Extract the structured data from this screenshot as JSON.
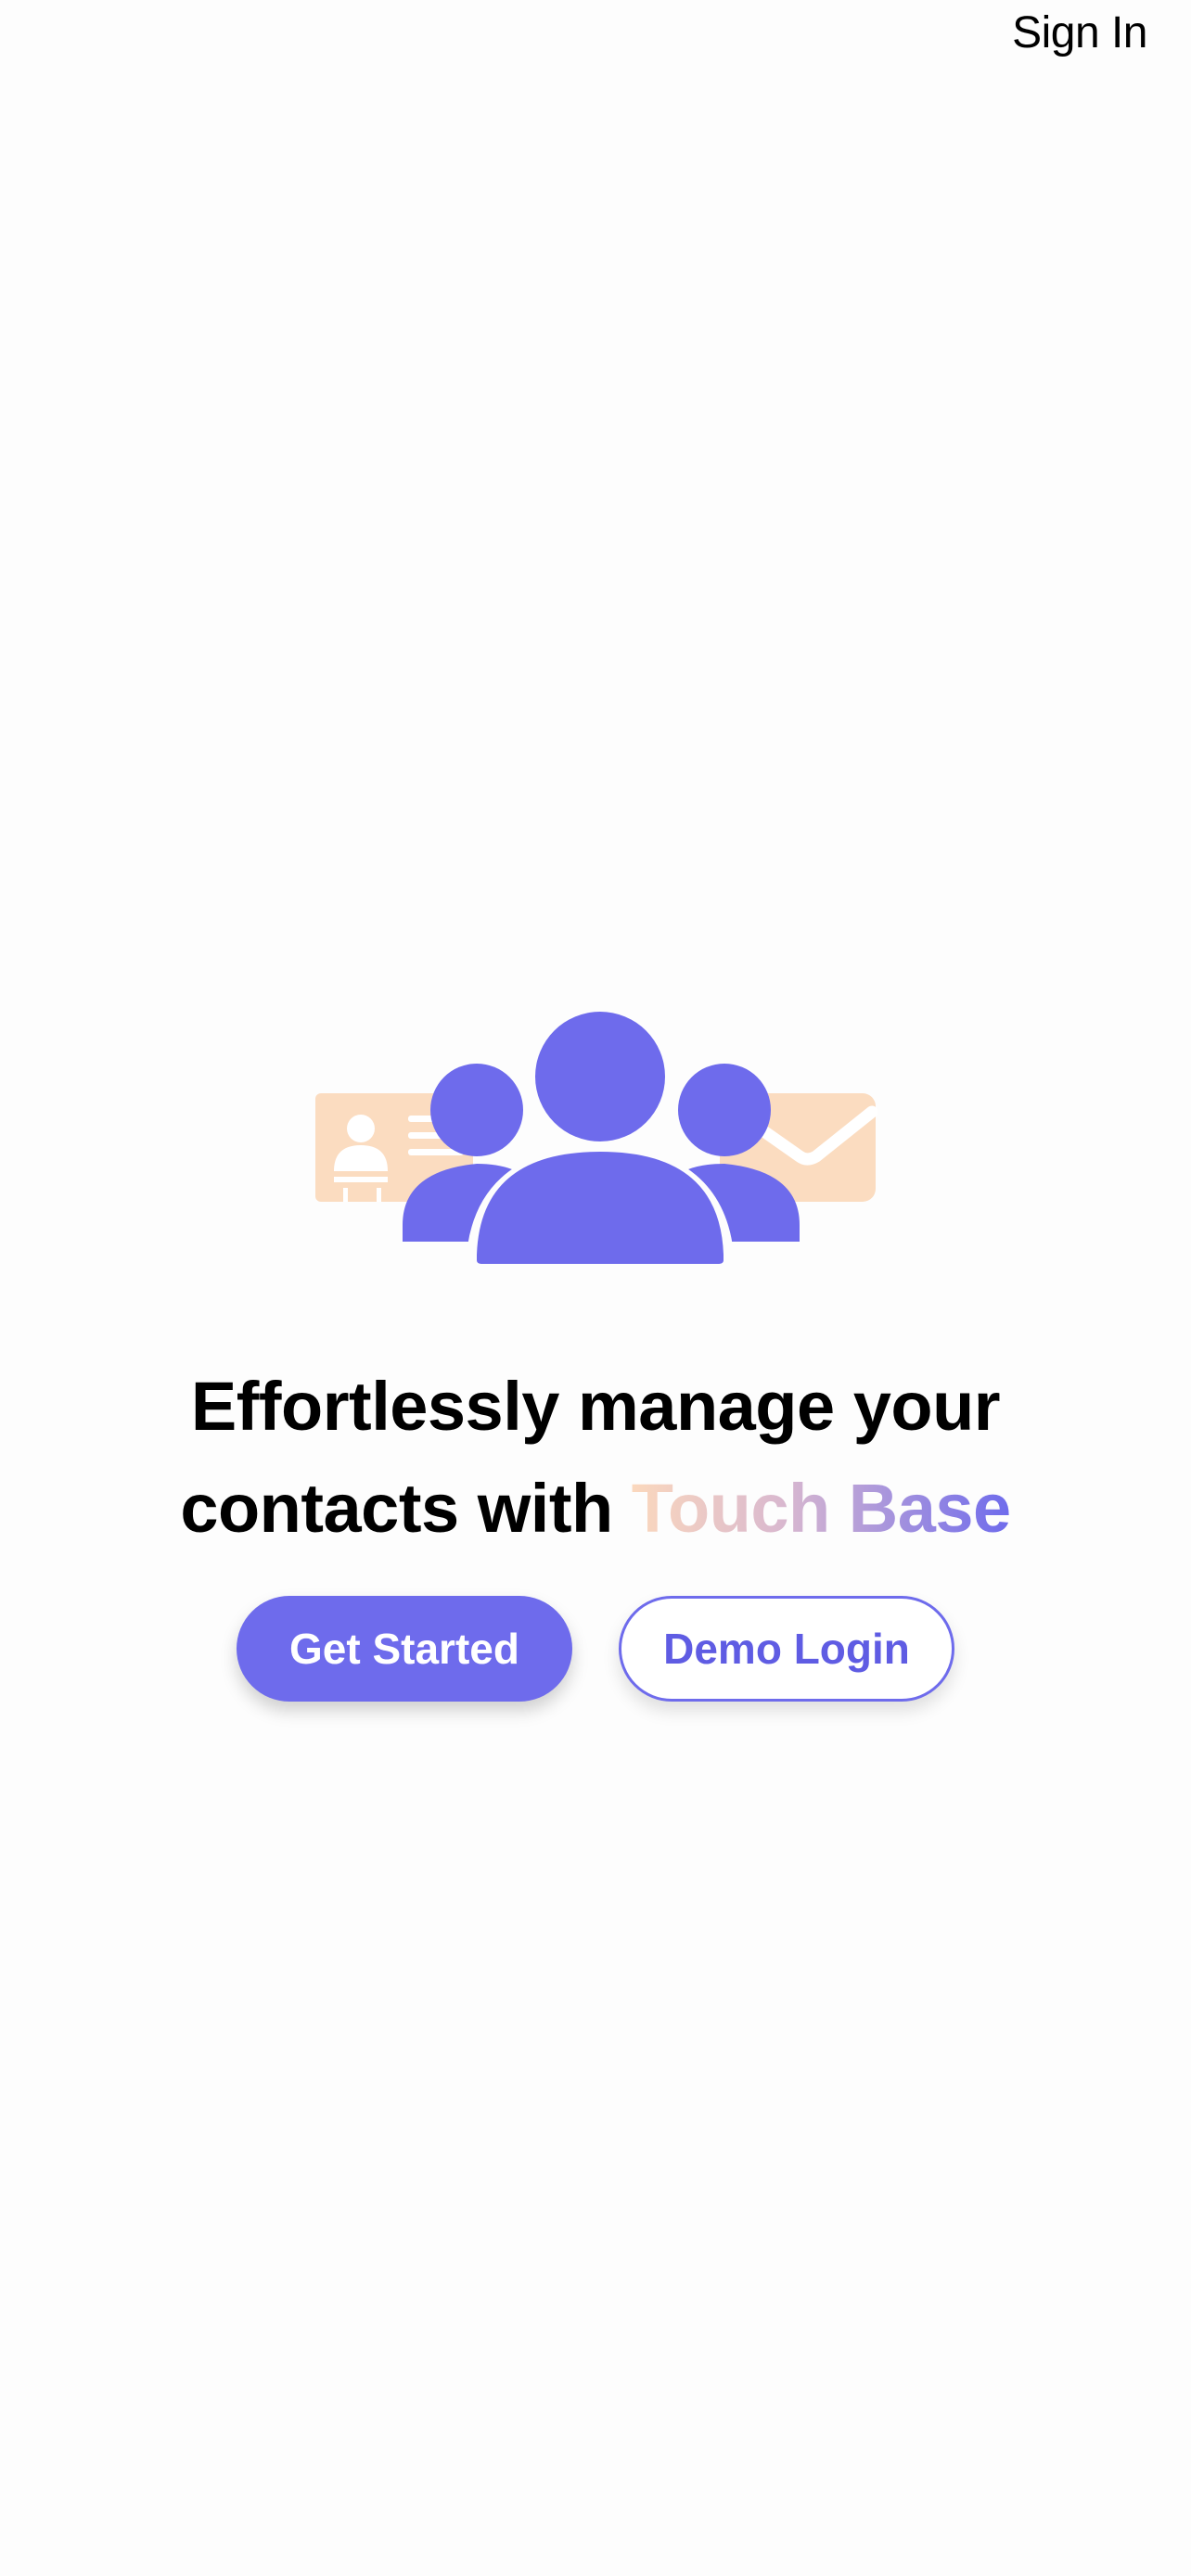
{
  "header": {
    "sign_in_label": "Sign In"
  },
  "hero": {
    "icon": "people-group-with-contact-card-and-envelope",
    "colors": {
      "primary": "#6e6bec",
      "accent": "#fbdcc0"
    }
  },
  "headline": {
    "line1": "Effortlessly manage your",
    "line2_prefix": "contacts with ",
    "brand": "Touch Base"
  },
  "actions": {
    "get_started_label": "Get Started",
    "demo_login_label": "Demo Login"
  }
}
